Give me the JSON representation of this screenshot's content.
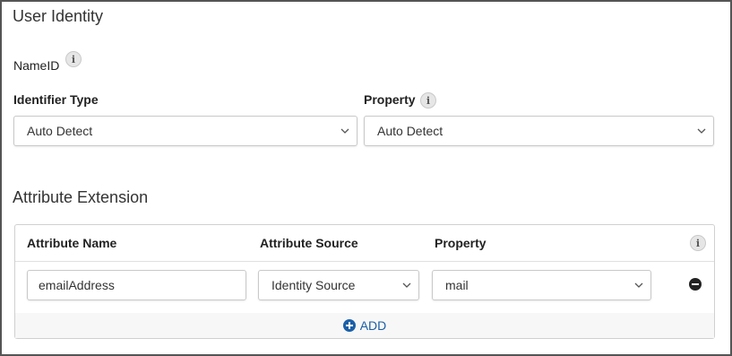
{
  "user_identity": {
    "title": "User Identity",
    "nameid_label": "NameID",
    "identifier_type_label": "Identifier Type",
    "identifier_type_value": "Auto Detect",
    "property_label": "Property",
    "property_value": "Auto Detect"
  },
  "attribute_extension": {
    "title": "Attribute Extension",
    "columns": {
      "name": "Attribute Name",
      "source": "Attribute Source",
      "property": "Property"
    },
    "rows": [
      {
        "name": "emailAddress",
        "source": "Identity Source",
        "property": "mail"
      }
    ],
    "add_label": "ADD"
  },
  "icons": {
    "info": "info-icon",
    "chevron": "chevron-down-icon",
    "remove": "remove-circle-icon",
    "add": "plus-circle-icon"
  },
  "colors": {
    "accent": "#1a5fa8",
    "border": "#c9c9c9",
    "text": "#222222"
  }
}
